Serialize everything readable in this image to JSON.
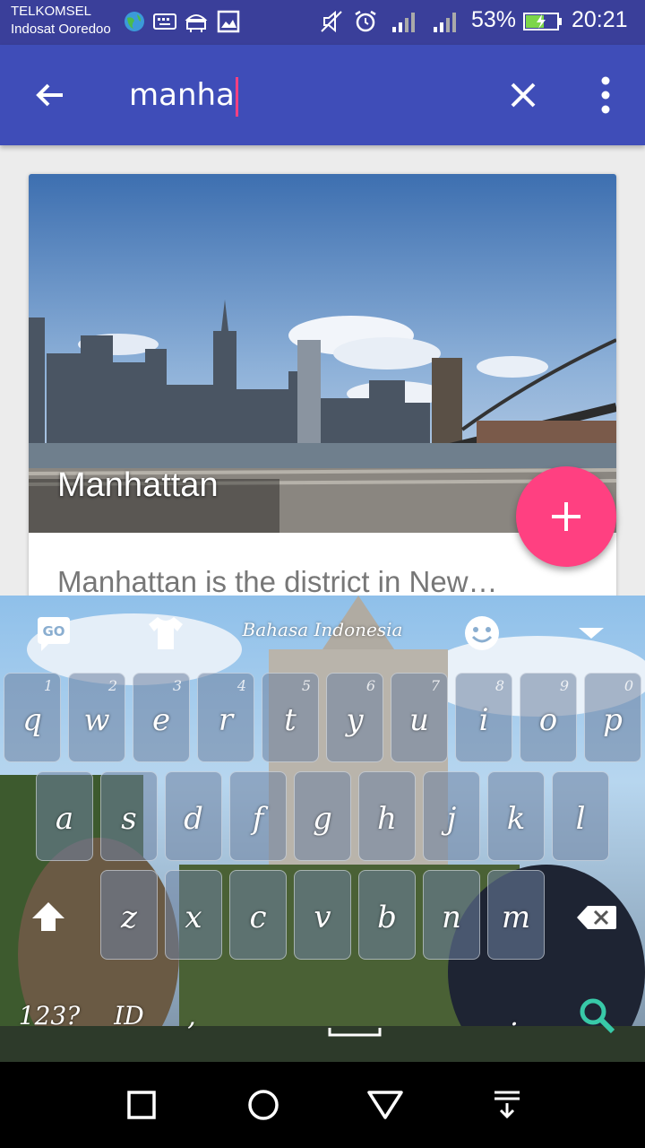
{
  "status_bar": {
    "carrier_1": "TELKOMSEL",
    "carrier_2": "Indosat Ooredoo",
    "battery": "53%",
    "time": "20:21"
  },
  "app_bar": {
    "query": "manha"
  },
  "card": {
    "title": "Manhattan",
    "description": "Manhattan is the district in New…"
  },
  "keyboard": {
    "language": "Bahasa Indonesia",
    "row1": [
      {
        "key": "q",
        "num": "1"
      },
      {
        "key": "w",
        "num": "2"
      },
      {
        "key": "e",
        "num": "3"
      },
      {
        "key": "r",
        "num": "4"
      },
      {
        "key": "t",
        "num": "5"
      },
      {
        "key": "y",
        "num": "6"
      },
      {
        "key": "u",
        "num": "7"
      },
      {
        "key": "i",
        "num": "8"
      },
      {
        "key": "o",
        "num": "9"
      },
      {
        "key": "p",
        "num": "0"
      }
    ],
    "row2": [
      "a",
      "s",
      "d",
      "f",
      "g",
      "h",
      "j",
      "k",
      "l"
    ],
    "row3": [
      "z",
      "x",
      "c",
      "v",
      "b",
      "n",
      "m"
    ],
    "symbols_label": "123?",
    "lang_key_label": "ID",
    "comma": ",",
    "period": "."
  },
  "colors": {
    "app_bar": "#3f4db8",
    "status_bar": "#3a3f9a",
    "fab": "#ff4081",
    "search_key": "#38c9a8"
  }
}
